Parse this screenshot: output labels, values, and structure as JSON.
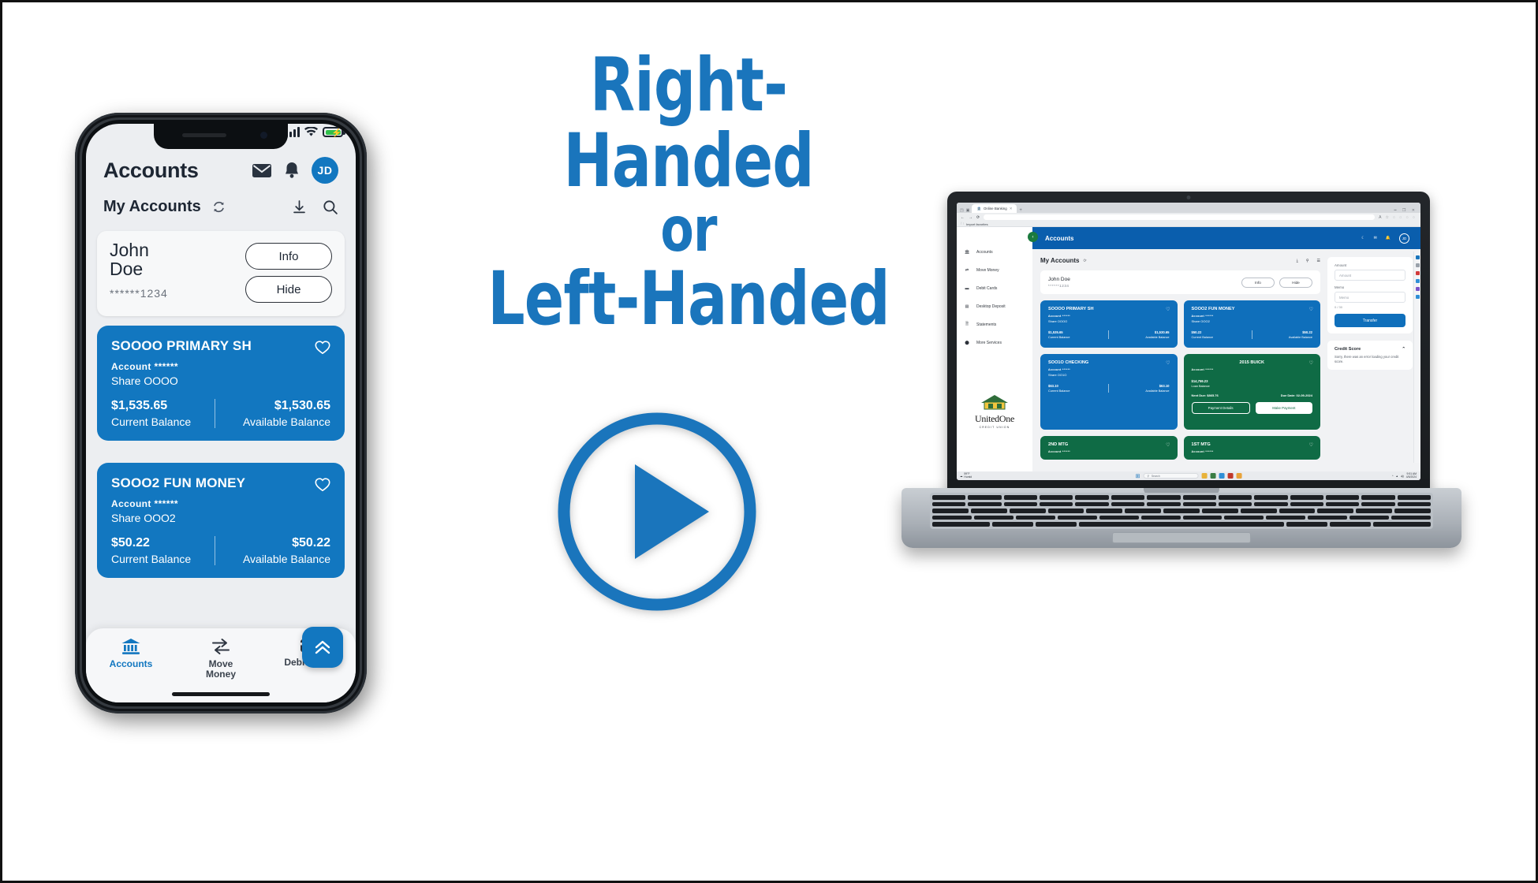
{
  "headline": {
    "line1": "Right-Handed",
    "line2": "or",
    "line3": "Left-Handed"
  },
  "play_button": {
    "name": "play-button"
  },
  "colors": {
    "accent_blue": "#1a75bc",
    "card_blue": "#1277c0",
    "card_green": "#0f6b45",
    "topbar_blue": "#0a5ead"
  },
  "phone": {
    "status": {
      "signal": "signal-bars",
      "wifi": "wifi-icon",
      "battery": "battery-charging-icon"
    },
    "header": {
      "title": "Accounts",
      "mail_icon": "mail-icon",
      "bell_icon": "bell-icon",
      "avatar_initials": "JD"
    },
    "subheader": {
      "title": "My Accounts",
      "refresh_icon": "refresh-icon",
      "download_icon": "download-icon",
      "search_icon": "search-icon"
    },
    "user_card": {
      "name_line1": "John",
      "name_line2": "Doe",
      "masked": "******1234",
      "info_label": "Info",
      "hide_label": "Hide"
    },
    "accounts": [
      {
        "title": "SOOOO PRIMARY SH",
        "account_label": "Account ******",
        "share": "Share OOOO",
        "current_amount": "$1,535.65",
        "current_label": "Current Balance",
        "available_amount": "$1,530.65",
        "available_label": "Available Balance"
      },
      {
        "title": "SOOO2 FUN MONEY",
        "account_label": "Account ******",
        "share": "Share OOO2",
        "current_amount": "$50.22",
        "current_label": "Current Balance",
        "available_amount": "$50.22",
        "available_label": "Available Balance"
      }
    ],
    "tabs": [
      {
        "label": "Accounts",
        "icon": "bank-icon",
        "active": true
      },
      {
        "label": "Move\nMoney",
        "label_1": "Move",
        "label_2": "Money",
        "icon": "transfer-icon",
        "active": false
      },
      {
        "label": "Debit Cards",
        "icon": "credit-card-icon",
        "active": false
      }
    ],
    "fab": {
      "icon": "chevron-double-up-icon"
    }
  },
  "laptop": {
    "browser": {
      "tab_title": "Online Banking",
      "new_tab": "+",
      "bookmark_label": "Import favorites",
      "back_icon": "back-arrow-icon",
      "forward_icon": "forward-arrow-icon",
      "reload_icon": "reload-icon"
    },
    "topbar": {
      "title": "Accounts",
      "moon_icon": "moon-icon",
      "mail_icon": "mail-icon",
      "bell_icon": "bell-icon",
      "avatar_initials": "JD",
      "collapse_icon": "collapse-icon"
    },
    "sidebar": {
      "items": [
        {
          "label": "Accounts",
          "icon": "bank-icon"
        },
        {
          "label": "Move Money",
          "icon": "transfer-icon"
        },
        {
          "label": "Debit Cards",
          "icon": "credit-card-icon"
        },
        {
          "label": "Desktop Deposit",
          "icon": "deposit-icon"
        },
        {
          "label": "Statements",
          "icon": "document-icon"
        },
        {
          "label": "More Services",
          "icon": "more-icon"
        }
      ],
      "logo": {
        "name": "UnitedOne",
        "tagline": "CREDIT UNION"
      }
    },
    "main": {
      "my_accounts": "My Accounts",
      "refresh_icon": "refresh-icon",
      "download_icon": "download-icon",
      "search_icon": "search-icon",
      "list_icon": "list-view-icon",
      "user": {
        "name": "John Doe",
        "masked": "******1234",
        "info_label": "Info",
        "hide_label": "Hide"
      },
      "cards": [
        {
          "title": "SOOOO PRIMARY SH",
          "account_label": "Account ******",
          "share": "Share OOOO",
          "current_amount": "$1,535.65",
          "current_label": "Current Balance",
          "available_amount": "$1,530.65",
          "available_label": "Available Balance",
          "color": "blue"
        },
        {
          "title": "SOOO2 FUN MONEY",
          "account_label": "Account ******",
          "share": "Share OOO2",
          "current_amount": "$50.22",
          "current_label": "Current Balance",
          "available_amount": "$50.22",
          "available_label": "Available Balance",
          "color": "blue"
        },
        {
          "title": "SOO1O CHECKING",
          "account_label": "Account ******",
          "share": "Share OO1O",
          "current_amount": "$63.10",
          "current_label": "Current Balance",
          "available_amount": "$63.10",
          "available_label": "Available Balance",
          "color": "blue"
        },
        {
          "title": "2015 BUICK",
          "account_label": "Account ******",
          "loan_amount": "$14,759.23",
          "loan_label": "Loan Balance",
          "next_due": "Next Due: $865.76",
          "due_date": "Due Date: 02-09-2024",
          "btn_details": "Payment Details",
          "btn_pay": "Make Payment",
          "color": "green"
        },
        {
          "title": "2ND MTG",
          "account_label": "Account ******",
          "color": "green"
        },
        {
          "title": "1ST MTG",
          "account_label": "Account ******",
          "color": "green"
        }
      ],
      "transfer_panel": {
        "amount_label": "Amount",
        "amount_placeholder": "Amount",
        "memo_label": "Memo",
        "memo_placeholder": "Memo",
        "counter": "0 / 30",
        "transfer_button": "Transfer"
      },
      "credit_score": {
        "title": "Credit Score",
        "chevron_icon": "chevron-up-icon",
        "body": "Sorry, there was an error loading your credit score."
      }
    },
    "taskbar": {
      "weather_temp": "59°F",
      "weather_desc": "Humid",
      "search_placeholder": "Search",
      "start_icon": "windows-start-icon",
      "time": "9:51 AM",
      "date": "4/5/2024"
    }
  }
}
